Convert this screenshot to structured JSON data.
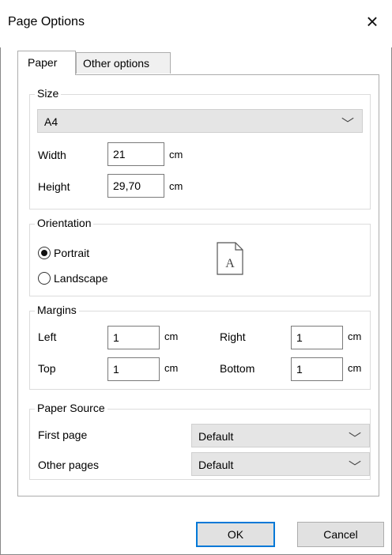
{
  "window": {
    "title": "Page Options",
    "close_glyph": "×"
  },
  "tabs": [
    {
      "label": "Paper",
      "selected": true
    },
    {
      "label": "Other options",
      "selected": false
    }
  ],
  "size": {
    "legend": "Size",
    "paper": "A4",
    "width_label": "Width",
    "width_value": "21",
    "width_unit": "cm",
    "height_label": "Height",
    "height_value": "29,70",
    "height_unit": "cm"
  },
  "orientation": {
    "legend": "Orientation",
    "portrait_label": "Portrait",
    "portrait_checked": true,
    "landscape_label": "Landscape",
    "landscape_checked": false,
    "preview_letter": "A"
  },
  "margins": {
    "legend": "Margins",
    "left_label": "Left",
    "left_value": "1",
    "left_unit": "cm",
    "right_label": "Right",
    "right_value": "1",
    "right_unit": "cm",
    "top_label": "Top",
    "top_value": "1",
    "top_unit": "cm",
    "bottom_label": "Bottom",
    "bottom_value": "1",
    "bottom_unit": "cm"
  },
  "paper_source": {
    "legend": "Paper Source",
    "first_page_label": "First page",
    "first_page_value": "Default",
    "other_pages_label": "Other pages",
    "other_pages_value": "Default"
  },
  "buttons": {
    "ok": "OK",
    "cancel": "Cancel"
  },
  "colors": {
    "accent": "#0078d7",
    "dropdown_bg": "#e5e5e5",
    "border": "#adadad"
  },
  "icons": {
    "close": "close-icon",
    "chevron": "chevron-down-icon",
    "page_preview": "page-preview-icon"
  }
}
